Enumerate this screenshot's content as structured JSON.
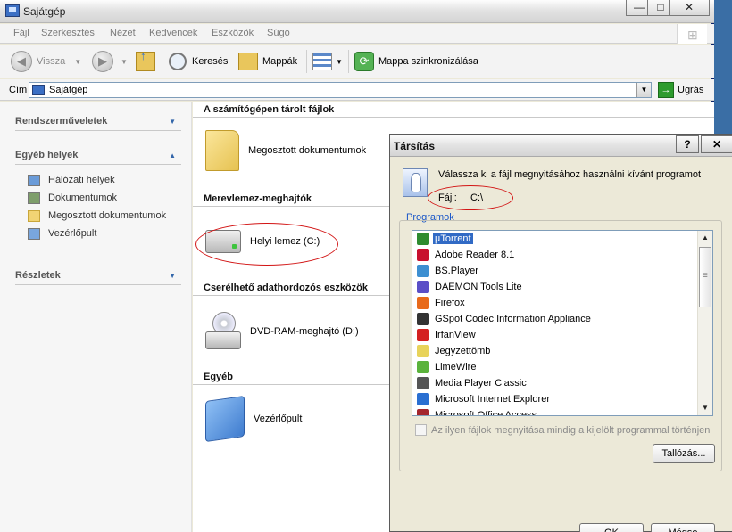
{
  "window": {
    "title": "Sajátgép",
    "controls": {
      "minimize": "—",
      "maximize": "□",
      "close": "✕"
    }
  },
  "menu": [
    "Fájl",
    "Szerkesztés",
    "Nézet",
    "Kedvencek",
    "Eszközök",
    "Súgó"
  ],
  "toolbar": {
    "back": "Vissza",
    "search": "Keresés",
    "folders": "Mappák",
    "sync": "Mappa szinkronizálása"
  },
  "address": {
    "label": "Cím",
    "value": "Sajátgép",
    "go": "Ugrás"
  },
  "left_pane": {
    "system_tasks": "Rendszerműveletek",
    "other_places": {
      "title": "Egyéb helyek",
      "items": [
        "Hálózati helyek",
        "Dokumentumok",
        "Megosztott dokumentumok",
        "Vezérlőpult"
      ]
    },
    "details": "Részletek"
  },
  "content": {
    "groups": {
      "stored_files": "A számítógépen tárolt fájlok",
      "hard_drives": "Merevlemez-meghajtók",
      "removable": "Cserélhető adathordozós eszközök",
      "other": "Egyéb"
    },
    "items": {
      "shared_docs": "Megosztott dokumentumok",
      "local_disk": "Helyi lemez (C:)",
      "dvd": "DVD-RAM-meghajtó (D:)",
      "control_panel": "Vezérlőpult"
    }
  },
  "dialog": {
    "title": "Társítás",
    "help": "?",
    "close": "✕",
    "instruction": "Válassza ki a fájl megnyitásához használni kívánt programot",
    "file_label": "Fájl:",
    "file_value": "C:\\",
    "programs_label": "Programok",
    "programs": [
      {
        "name": "µTorrent",
        "color": "#2e8b2e"
      },
      {
        "name": "Adobe Reader 8.1",
        "color": "#c8102e"
      },
      {
        "name": "BS.Player",
        "color": "#3d8fd1"
      },
      {
        "name": "DAEMON Tools Lite",
        "color": "#5a4fc7"
      },
      {
        "name": "Firefox",
        "color": "#e86a1a"
      },
      {
        "name": "GSpot Codec Information Appliance",
        "color": "#333333"
      },
      {
        "name": "IrfanView",
        "color": "#d42020"
      },
      {
        "name": "Jegyzettömb",
        "color": "#e8d35a"
      },
      {
        "name": "LimeWire",
        "color": "#5bb33b"
      },
      {
        "name": "Media Player Classic",
        "color": "#555555"
      },
      {
        "name": "Microsoft Internet Explorer",
        "color": "#2a6fd1"
      },
      {
        "name": "Microsoft Office Access",
        "color": "#a4262c"
      }
    ],
    "selected_index": 0,
    "always_use": "Az ilyen fájlok megnyitása mindig a kijelölt programmal történjen",
    "browse": "Tallózás...",
    "ok": "OK",
    "cancel": "Mégse"
  }
}
